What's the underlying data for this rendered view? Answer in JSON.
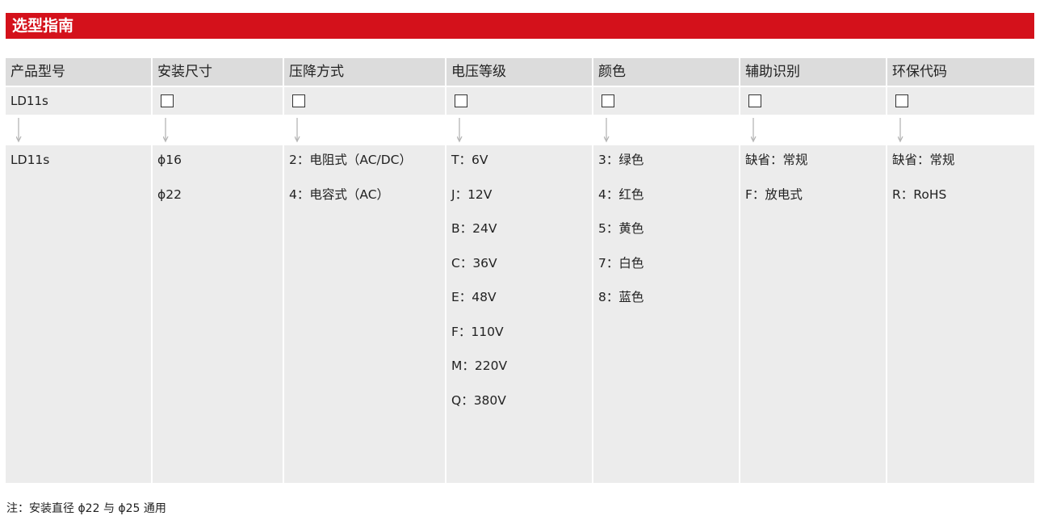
{
  "title": "选型指南",
  "columns": [
    {
      "header": "产品型号",
      "selector_text": "LD11s",
      "has_box": false,
      "items": [
        "LD11s"
      ]
    },
    {
      "header": "安装尺寸",
      "selector_text": "",
      "has_box": true,
      "items": [
        "ϕ16",
        "ϕ22"
      ]
    },
    {
      "header": "压降方式",
      "selector_text": "",
      "has_box": true,
      "items": [
        "2：电阻式（AC/DC）",
        "4：电容式（AC）"
      ]
    },
    {
      "header": "电压等级",
      "selector_text": "",
      "has_box": true,
      "items": [
        "T：6V",
        "J：12V",
        "B：24V",
        "C：36V",
        "E：48V",
        "F：110V",
        "M：220V",
        "Q：380V"
      ]
    },
    {
      "header": "颜色",
      "selector_text": "",
      "has_box": true,
      "items": [
        "3：绿色",
        "4：红色",
        "5：黄色",
        "7：白色",
        "8：蓝色"
      ]
    },
    {
      "header": "辅助识别",
      "selector_text": "",
      "has_box": true,
      "items": [
        "缺省：常规",
        "F：放电式"
      ]
    },
    {
      "header": "环保代码",
      "selector_text": "",
      "has_box": true,
      "items": [
        "缺省：常规",
        "R：RoHS"
      ]
    }
  ],
  "note": "注：安装直径 ϕ22 与 ϕ25 通用",
  "colors": {
    "banner": "#d4111b",
    "header_bg": "#dcdcdc",
    "cell_bg": "#ececec"
  }
}
